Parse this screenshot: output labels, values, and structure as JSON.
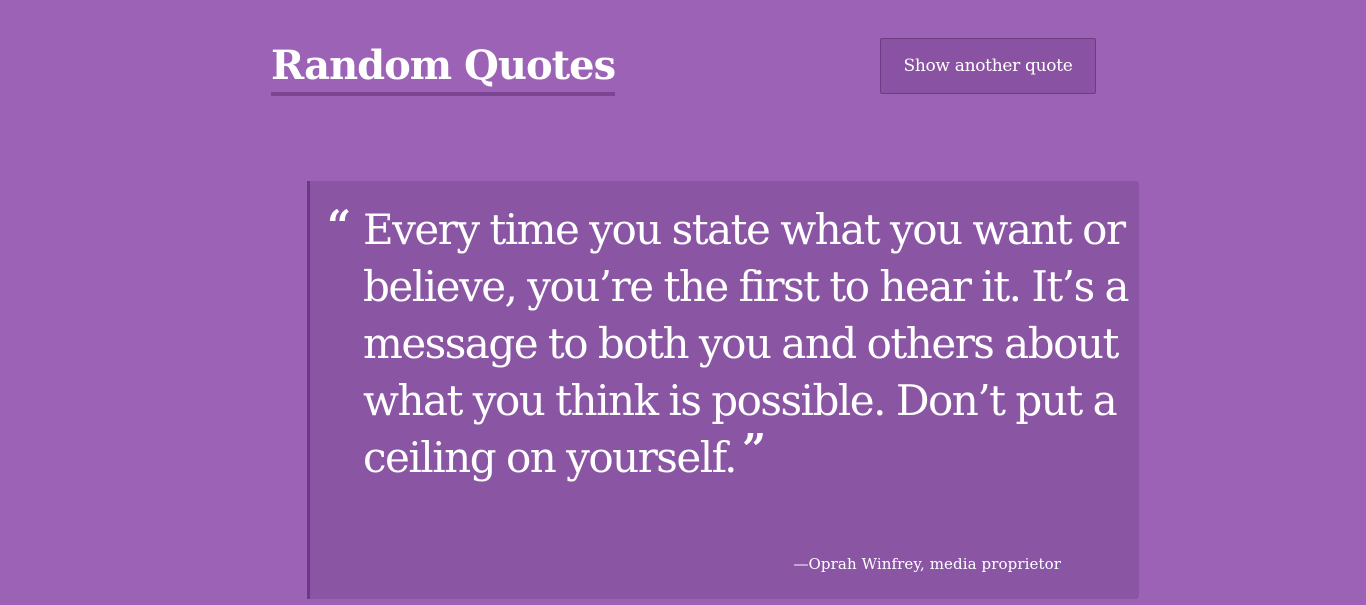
{
  "header": {
    "title": "Random Quotes",
    "button_label": "Show another quote"
  },
  "quote": {
    "open_mark": "“",
    "text": "Every time you state what you want or believe, you’re the first to hear it. It’s a message to both you and others about what you think is possible. Don’t put a ceiling on yourself.",
    "close_mark": "”",
    "attribution": "—Oprah Winfrey, media proprietor"
  },
  "colors": {
    "background": "#9c62b6",
    "quote_box": "#8a56a4",
    "accent_border": "#6d3888",
    "text": "#ffffff"
  }
}
